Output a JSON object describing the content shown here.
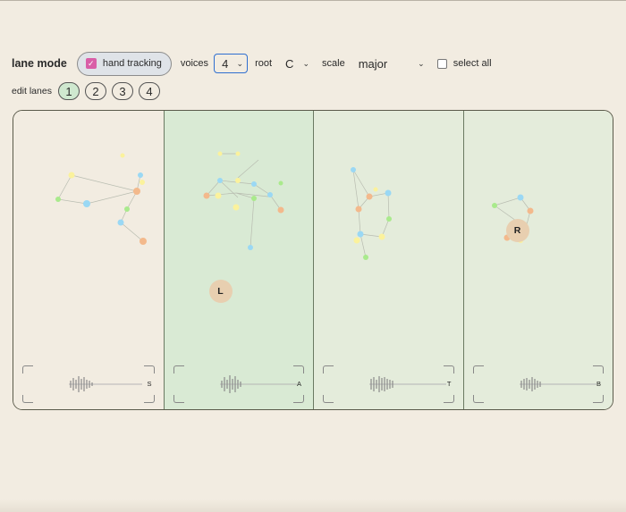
{
  "toolbar": {
    "lane_mode_label": "lane mode",
    "hand_tracking_label": "hand tracking",
    "hand_tracking_checked": true,
    "voices_label": "voices",
    "voices_value": "4",
    "root_label": "root",
    "root_value": "C",
    "scale_label": "scale",
    "scale_value": "major",
    "select_all_label": "select all",
    "select_all_checked": false
  },
  "edit_lanes": {
    "label": "edit lanes",
    "buttons": [
      "1",
      "2",
      "3",
      "4"
    ],
    "active": "1"
  },
  "lanes": [
    {
      "voice": "S",
      "selected": false,
      "hand_label": ""
    },
    {
      "voice": "A",
      "selected": true,
      "hand_label": "L"
    },
    {
      "voice": "T",
      "selected": false,
      "hand_label": ""
    },
    {
      "voice": "B",
      "selected": false,
      "hand_label": "R"
    }
  ],
  "colors": {
    "background": "#f2ece1",
    "lane_plain": "#f2ece1",
    "lane_tinted": "#e4ecdb",
    "lane_selected": "#d9ead4",
    "checkbox_accent": "#d95fa7",
    "focus_blue": "#2f6fd0",
    "active_lane_button": "#cfe8cf",
    "hand_marker": "#e8cfb0"
  },
  "icons": {
    "checkbox_checked": "check-icon",
    "select_arrow": "chevron-down-icon"
  }
}
